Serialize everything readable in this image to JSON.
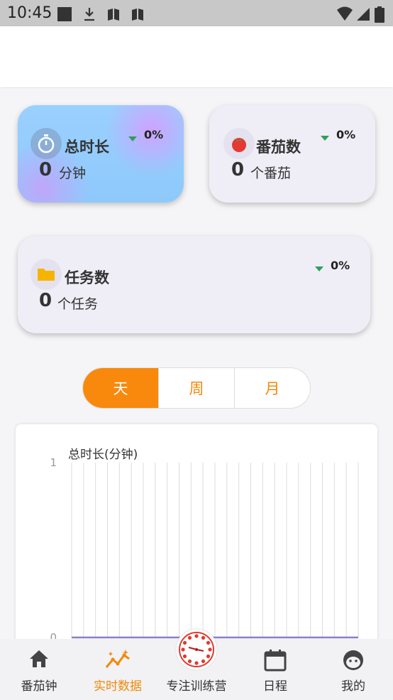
{
  "status_bar": {
    "time": "10:45"
  },
  "cards": {
    "total_time": {
      "title": "总时长",
      "value": "0",
      "unit": "分钟",
      "percent": "0%"
    },
    "pomodoros": {
      "title": "番茄数",
      "value": "0",
      "unit": "个番茄",
      "percent": "0%"
    },
    "tasks": {
      "title": "任务数",
      "value": "0",
      "unit": "个任务",
      "percent": "0%"
    }
  },
  "period_tabs": [
    "天",
    "周",
    "月"
  ],
  "period_selected": "天",
  "colors": {
    "accent": "#f8890c",
    "trend_down": "#2e9e5b",
    "card_bg": "#efeef7",
    "line": "#8a7fc8"
  },
  "chart_data": {
    "type": "line",
    "ylabel": "总时长(分钟)",
    "ylim": [
      0,
      1
    ],
    "yticks": [
      "1",
      "0"
    ],
    "x_count": 24,
    "values": [
      0,
      0,
      0,
      0,
      0,
      0,
      0,
      0,
      0,
      0,
      0,
      0,
      0,
      0,
      0,
      0,
      0,
      0,
      0,
      0,
      0,
      0,
      0,
      0
    ],
    "grid": "vertical"
  },
  "tabbar": {
    "items": [
      {
        "label": "番茄钟",
        "icon": "home-icon"
      },
      {
        "label": "实时数据",
        "icon": "trend-chart-icon",
        "active": true
      },
      {
        "label": "专注训练营",
        "icon": "clock-fab-icon"
      },
      {
        "label": "日程",
        "icon": "calendar-icon"
      },
      {
        "label": "我的",
        "icon": "face-icon"
      }
    ]
  }
}
